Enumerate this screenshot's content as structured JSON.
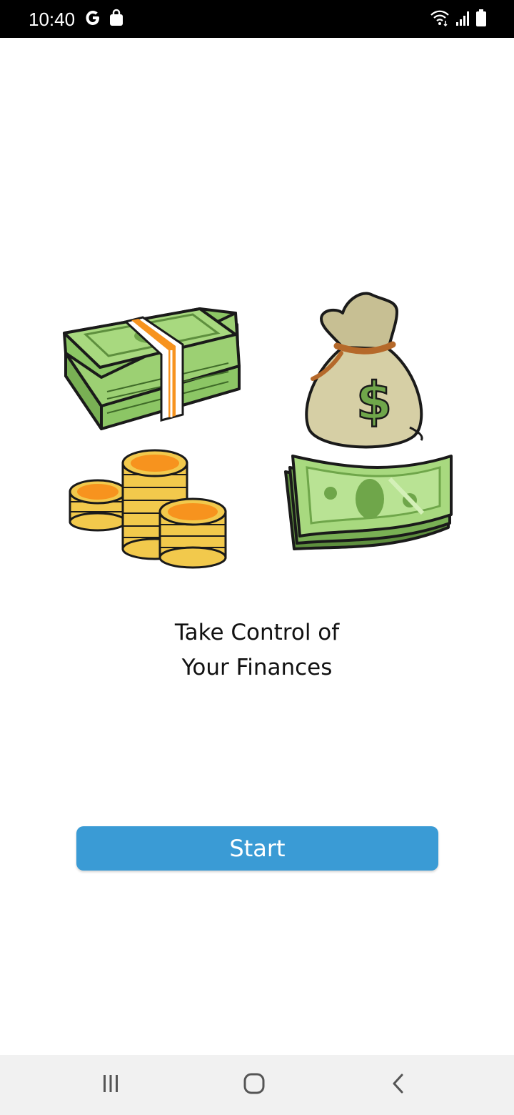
{
  "status_bar": {
    "time": "10:40",
    "left_icons": [
      "google-icon",
      "shopping-bag-icon"
    ],
    "right_icons": [
      "wifi-icon",
      "signal-icon",
      "battery-icon"
    ]
  },
  "main": {
    "illustrations": [
      "cash-stack-icon",
      "money-bag-icon",
      "coins-stack-icon",
      "banknotes-icon"
    ],
    "headline_line1": "Take Control of",
    "headline_line2": "Your Finances",
    "start_label": "Start"
  },
  "nav_bar": {
    "buttons": [
      "recents-icon",
      "home-icon",
      "back-icon"
    ]
  },
  "colors": {
    "status_bar_bg": "#000000",
    "button_bg": "#3a9bd5",
    "nav_bar_bg": "#f1f1f1",
    "cash_green": "#8cc665",
    "coin_gold": "#f2c94c",
    "coin_orange": "#f7931e",
    "bag_beige": "#d6cfa5"
  }
}
